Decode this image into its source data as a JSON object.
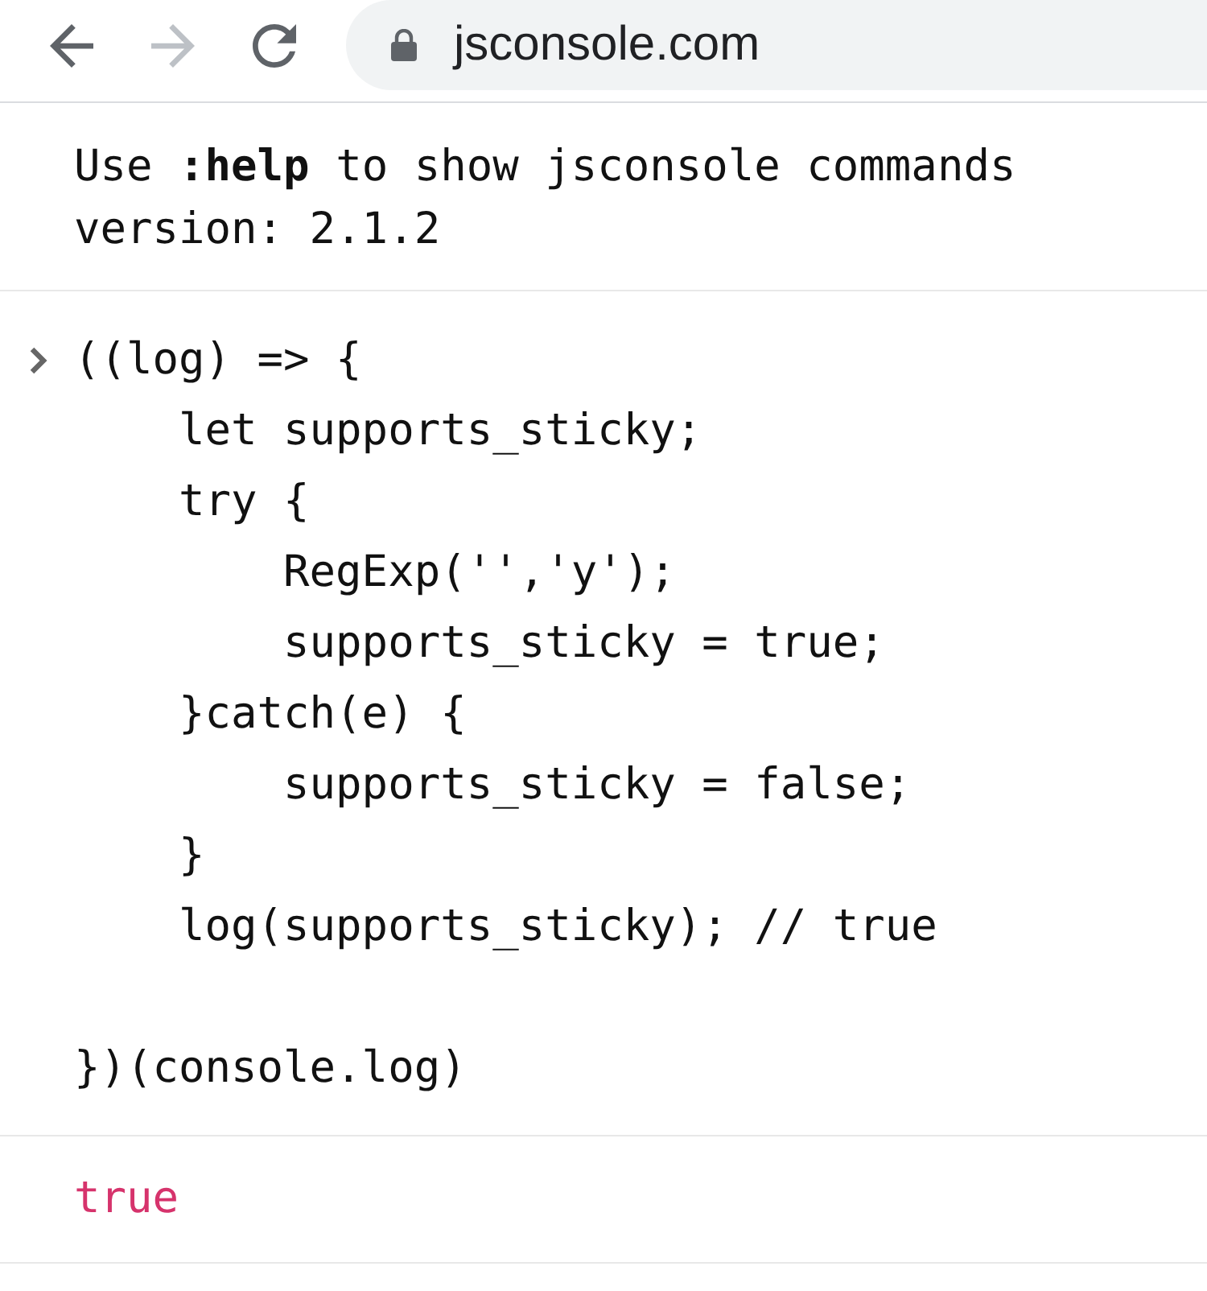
{
  "browser": {
    "nav_buttons": [
      {
        "kind": "back",
        "disabled": false
      },
      {
        "kind": "forward",
        "disabled": true
      },
      {
        "kind": "reload",
        "disabled": false
      }
    ],
    "address": {
      "secure": true,
      "url": "jsconsole.com"
    }
  },
  "console": {
    "intro": [
      "Use **:help** to show jsconsole commands",
      "version: 2.1.2"
    ],
    "entries": [
      {
        "kind": "input",
        "code": "((log) => {\n    let supports_sticky;\n    try {\n        RegExp('','y');\n        supports_sticky = true;\n    }catch(e) {\n        supports_sticky = false;\n    }\n    log(supports_sticky); // true\n\n})(console.log)"
      },
      {
        "kind": "result",
        "text": "true"
      }
    ]
  }
}
